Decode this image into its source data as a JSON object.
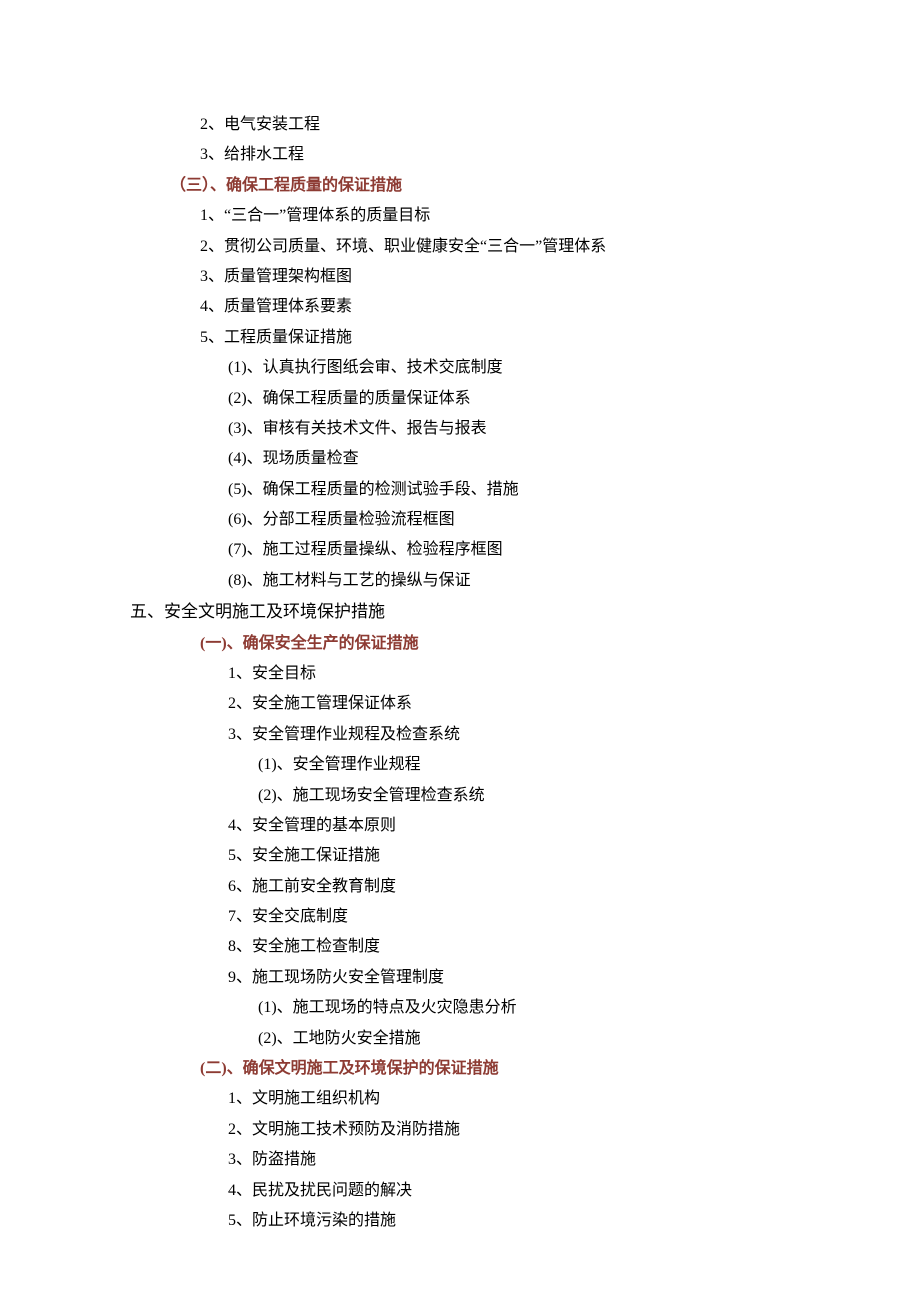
{
  "lines": [
    {
      "cls": "l1",
      "t": "2、电气安装工程"
    },
    {
      "cls": "l1",
      "t": "3、给排水工程"
    },
    {
      "cls": "section-head2",
      "t": "（三）、确保工程质量的保证措施"
    },
    {
      "cls": "l1",
      "t": "1、“三合一”管理体系的质量目标"
    },
    {
      "cls": "l1",
      "t": "2、贯彻公司质量、环境、职业健康安全“三合一”管理体系"
    },
    {
      "cls": "l1",
      "t": "3、质量管理架构框图"
    },
    {
      "cls": "l1",
      "t": "4、质量管理体系要素"
    },
    {
      "cls": "l1",
      "t": "5、工程质量保证措施"
    },
    {
      "cls": "l2",
      "t": "(1)、认真执行图纸会审、技术交底制度"
    },
    {
      "cls": "l2",
      "t": "(2)、确保工程质量的质量保证体系"
    },
    {
      "cls": "l2",
      "t": "(3)、审核有关技术文件、报告与报表"
    },
    {
      "cls": "l2",
      "t": "(4)、现场质量检查"
    },
    {
      "cls": "l2",
      "t": "(5)、确保工程质量的检测试验手段、措施"
    },
    {
      "cls": "l2",
      "t": "(6)、分部工程质量检验流程框图"
    },
    {
      "cls": "l2",
      "t": "(7)、施工过程质量操纵、检验程序框图"
    },
    {
      "cls": "l2",
      "t": "(8)、施工材料与工艺的操纵与保证"
    },
    {
      "cls": "h1",
      "t": "五、安全文明施工及环境保护措施"
    },
    {
      "cls": "section-head",
      "t": "(一)、确保安全生产的保证措施"
    },
    {
      "cls": "l2",
      "t": "1、安全目标"
    },
    {
      "cls": "l2",
      "t": "2、安全施工管理保证体系"
    },
    {
      "cls": "l2",
      "t": "3、安全管理作业规程及检查系统"
    },
    {
      "cls": "l3",
      "t": "(1)、安全管理作业规程"
    },
    {
      "cls": "l3",
      "t": "(2)、施工现场安全管理检查系统"
    },
    {
      "cls": "l2",
      "t": "4、安全管理的基本原则"
    },
    {
      "cls": "l2",
      "t": "5、安全施工保证措施"
    },
    {
      "cls": "l2",
      "t": "6、施工前安全教育制度"
    },
    {
      "cls": "l2",
      "t": "7、安全交底制度"
    },
    {
      "cls": "l2",
      "t": "8、安全施工检查制度"
    },
    {
      "cls": "l2",
      "t": "9、施工现场防火安全管理制度"
    },
    {
      "cls": "l3",
      "t": "(1)、施工现场的特点及火灾隐患分析"
    },
    {
      "cls": "l3",
      "t": "(2)、工地防火安全措施"
    },
    {
      "cls": "section-head",
      "t": "(二)、确保文明施工及环境保护的保证措施"
    },
    {
      "cls": "l2",
      "t": "1、文明施工组织机构"
    },
    {
      "cls": "l2",
      "t": "2、文明施工技术预防及消防措施"
    },
    {
      "cls": "l2",
      "t": "3、防盗措施"
    },
    {
      "cls": "l2",
      "t": "4、民扰及扰民问题的解决"
    },
    {
      "cls": "l2",
      "t": "5、防止环境污染的措施"
    }
  ]
}
